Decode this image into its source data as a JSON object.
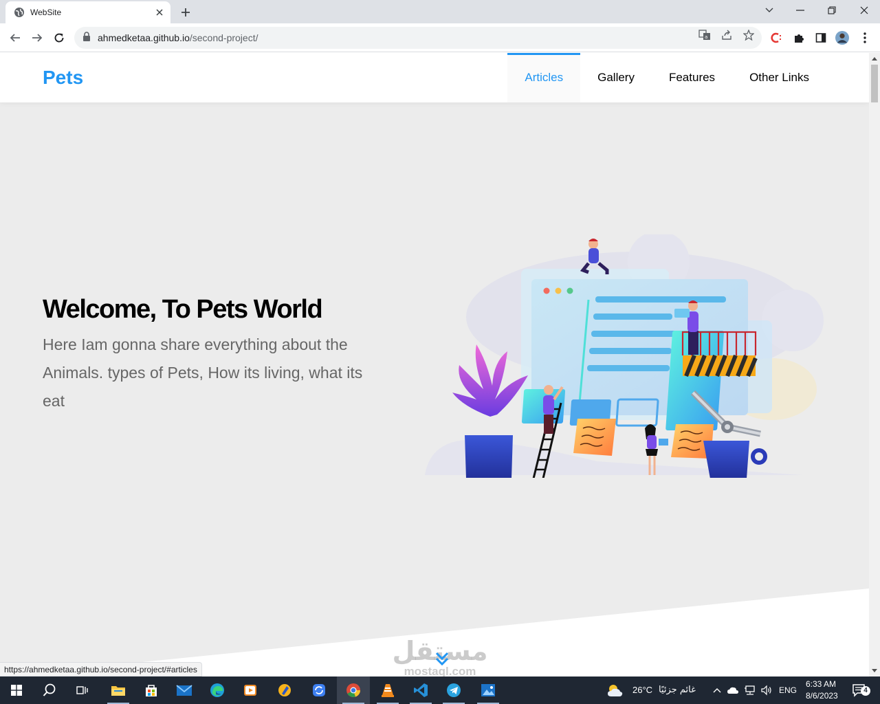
{
  "browser": {
    "tab_title": "WebSite",
    "url_host": "ahmedketaa.github.io",
    "url_path": "/second-project/",
    "status_url": "https://ahmedketaa.github.io/second-project/#articles"
  },
  "site": {
    "logo": "Pets",
    "nav": [
      {
        "label": "Articles",
        "active": true
      },
      {
        "label": "Gallery",
        "active": false
      },
      {
        "label": "Features",
        "active": false
      },
      {
        "label": "Other Links",
        "active": false
      }
    ],
    "hero_title": "Welcome, To Pets World",
    "hero_text": "Here Iam gonna share everything about the Animals. types of Pets, How its living, what its eat",
    "accent": "#2196f3"
  },
  "watermark": {
    "arabic": "مستقل",
    "latin": "mostaql.com"
  },
  "taskbar": {
    "weather_temp": "26°C",
    "weather_text": "غائم جزئيًا",
    "lang": "ENG",
    "time": "6:33 AM",
    "date": "8/6/2023",
    "notifications": "4"
  }
}
